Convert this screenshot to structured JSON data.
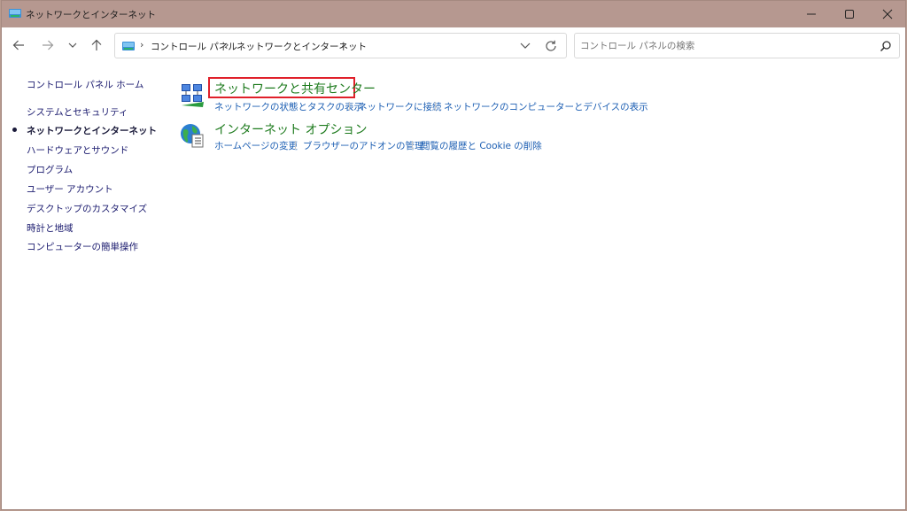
{
  "window": {
    "title": "ネットワークとインターネット"
  },
  "nav": {
    "breadcrumb": [
      "コントロール パネル",
      "ネットワークとインターネット"
    ]
  },
  "search": {
    "placeholder": "コントロール パネルの検索"
  },
  "sidebar": {
    "items": [
      {
        "label": "コントロール パネル ホーム",
        "active": false
      },
      {
        "label": "システムとセキュリティ",
        "active": false
      },
      {
        "label": "ネットワークとインターネット",
        "active": true
      },
      {
        "label": "ハードウェアとサウンド",
        "active": false
      },
      {
        "label": "プログラム",
        "active": false
      },
      {
        "label": "ユーザー アカウント",
        "active": false
      },
      {
        "label": "デスクトップのカスタマイズ",
        "active": false
      },
      {
        "label": "時計と地域",
        "active": false
      },
      {
        "label": "コンピューターの簡単操作",
        "active": false
      }
    ]
  },
  "categories": [
    {
      "title": "ネットワークと共有センター",
      "icon": "network-sharing-center-icon",
      "links": [
        "ネットワークの状態とタスクの表示",
        "ネットワークに接続",
        "ネットワークのコンピューターとデバイスの表示"
      ]
    },
    {
      "title": "インターネット オプション",
      "icon": "internet-options-icon",
      "links": [
        "ホームページの変更",
        "ブラウザーのアドオンの管理",
        "閲覧の履歴と Cookie の削除"
      ]
    }
  ],
  "colors": {
    "titlebar": "#b69890",
    "category_title": "#1e7b1e",
    "link": "#1d5fb3",
    "highlight": "#e0202a"
  }
}
